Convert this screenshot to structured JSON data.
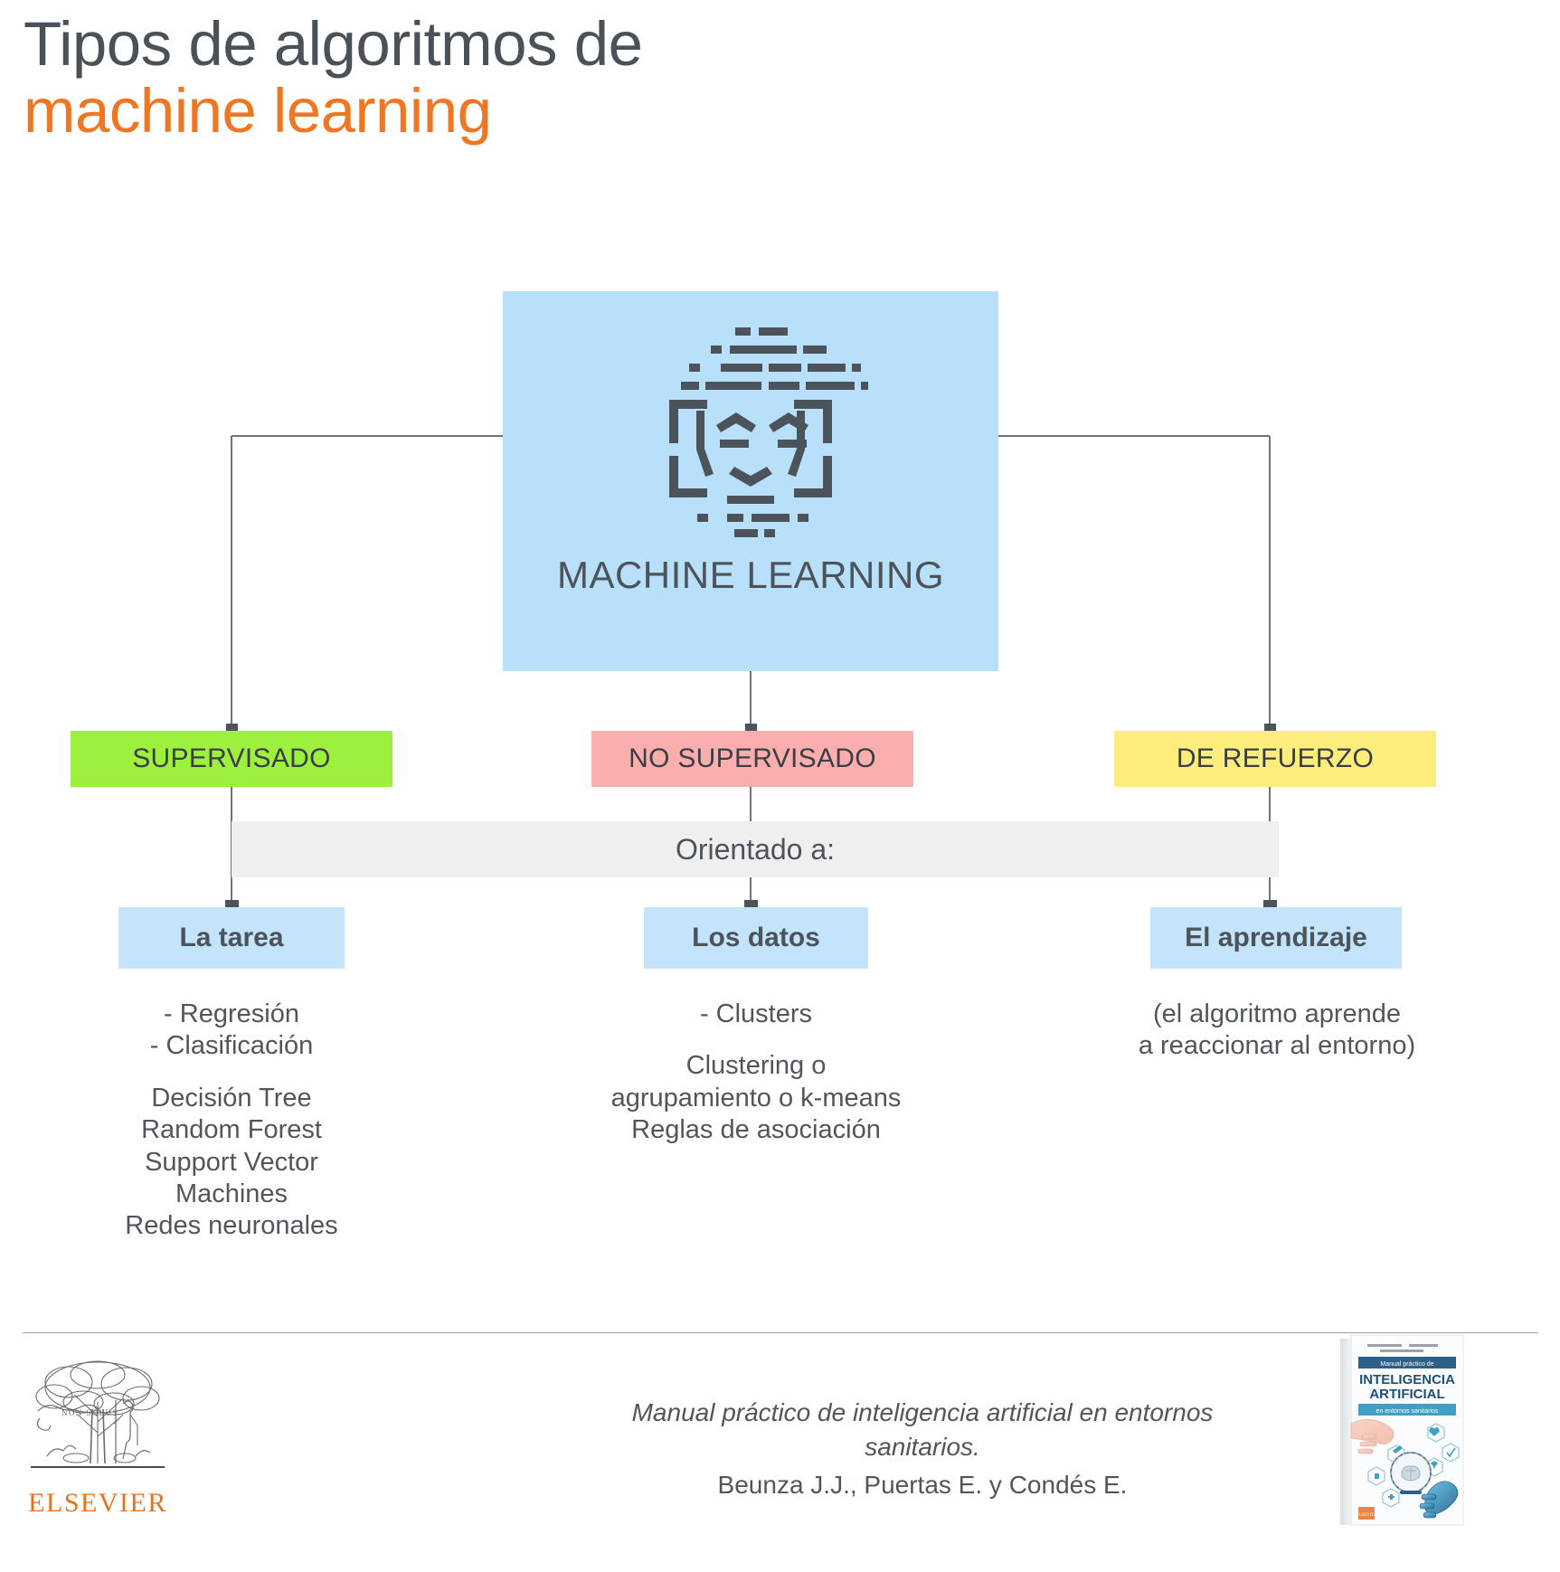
{
  "title": {
    "line1": "Tipos de algoritmos de",
    "line2": "machine learning",
    "line1_color": "#4a5157",
    "line2_color": "#ef7622"
  },
  "diagram": {
    "root": {
      "label": "MACHINE LEARNING",
      "icon": "ai-face-icon",
      "background_color": "#b9e0fa"
    },
    "categories": [
      {
        "label": "SUPERVISADO",
        "color": "#9ef03f"
      },
      {
        "label": "NO SUPERVISADO",
        "color": "#fcadad"
      },
      {
        "label": "DE REFUERZO",
        "color": "#fced7c"
      }
    ],
    "band_label": "Orientado a:",
    "band_color": "#efefef",
    "subnodes": [
      {
        "label": "La tarea",
        "color": "#c3e4fb"
      },
      {
        "label": "Los datos",
        "color": "#c3e4fb"
      },
      {
        "label": "El aprendizaje",
        "color": "#c3e4fb"
      }
    ],
    "details": [
      {
        "group_a": [
          "- Regresión",
          "- Clasificación"
        ],
        "group_b": [
          "Decisión Tree",
          "Random Forest",
          "Support Vector",
          "Machines",
          "Redes neuronales"
        ]
      },
      {
        "group_a": [
          "- Clusters"
        ],
        "group_b": [
          "Clustering o",
          "agrupamiento o k-means",
          "Reglas de asociación"
        ]
      },
      {
        "group_a": [
          "(el algoritmo aprende",
          "a reaccionar al entorno)"
        ],
        "group_b": []
      }
    ]
  },
  "footer": {
    "publisher_name": "ELSEVIER",
    "publisher_logo_motto": "NON SOLUS",
    "citation_title": "Manual práctico de inteligencia artificial en entornos sanitarios.",
    "citation_authors": "Beunza J.J., Puertas E. y Condés E.",
    "book_cover": {
      "authors": "JUAN JOSÉ BEUNZA NUIN · ENRIQUE PUERTAS SANZ · EMILIA CONDÉS MORENO",
      "kicker": "Manual práctico de",
      "title_line1": "INTELIGENCIA",
      "title_line2": "ARTIFICIAL",
      "subtitle": "en entornos sanitarios",
      "publisher": "ELSEVIER"
    }
  }
}
